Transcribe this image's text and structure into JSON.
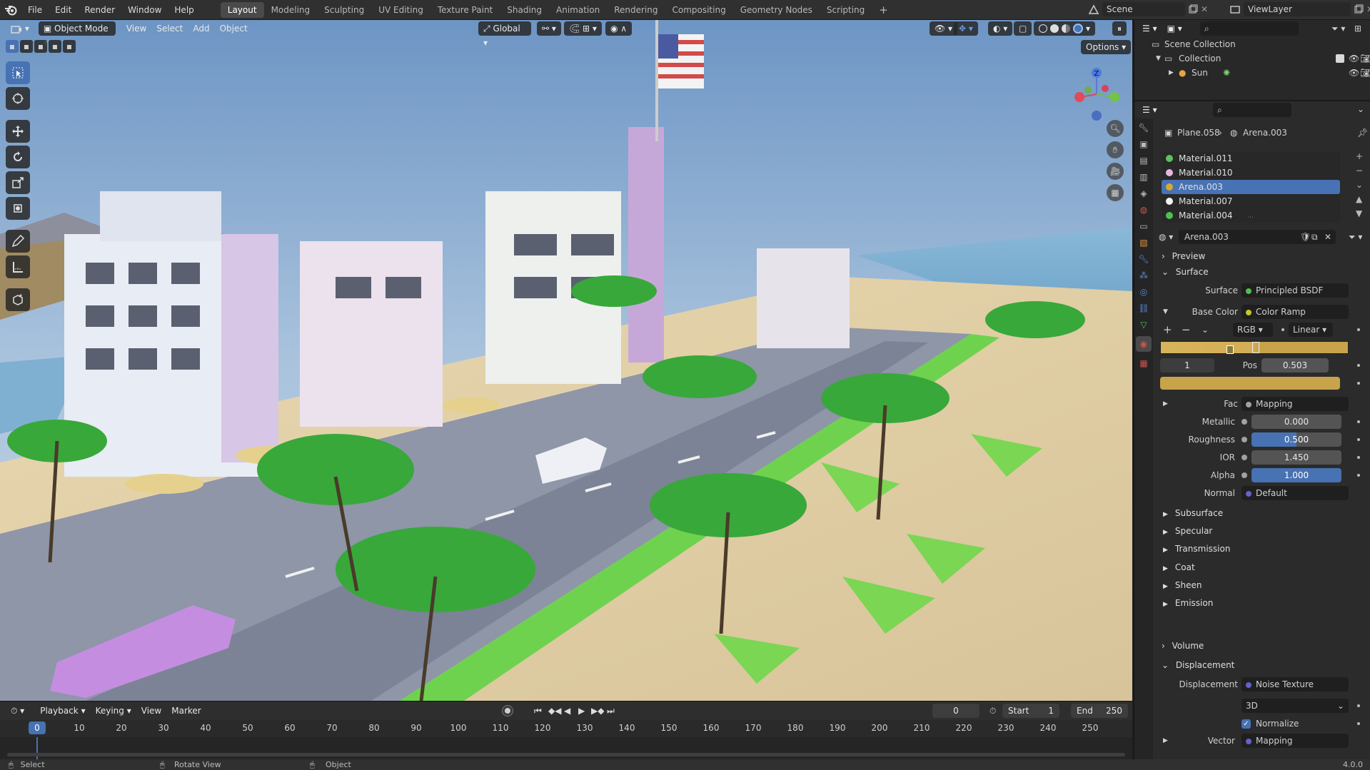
{
  "colors": {
    "accent": "#4772b3",
    "header": "#303030",
    "panel": "#2b2b2b",
    "socket_yellow": "#c7c729",
    "socket_purple": "#6363c7",
    "socket_gray": "#a1a1a1",
    "ramp_left": "#d7b45a",
    "ramp_right": "#c7a44a"
  },
  "menu": [
    "File",
    "Edit",
    "Render",
    "Window",
    "Help"
  ],
  "workspaces": [
    "Layout",
    "Modeling",
    "Sculpting",
    "UV Editing",
    "Texture Paint",
    "Shading",
    "Animation",
    "Rendering",
    "Compositing",
    "Geometry Nodes",
    "Scripting"
  ],
  "workspace_active": "Layout",
  "scene": {
    "name": "Scene",
    "view_layer": "ViewLayer"
  },
  "viewport": {
    "mode": "Object Mode",
    "menus": [
      "View",
      "Select",
      "Add",
      "Object"
    ],
    "orientation": "Global",
    "options": "Options",
    "gizmo_axis": "Z"
  },
  "timeline": {
    "menus": [
      "Playback",
      "Keying",
      "View",
      "Marker"
    ],
    "current_frame": "0",
    "start_label": "Start",
    "start": "1",
    "end_label": "End",
    "end": "250",
    "ticks": [
      "0",
      "10",
      "20",
      "30",
      "40",
      "50",
      "60",
      "70",
      "80",
      "90",
      "100",
      "110",
      "120",
      "130",
      "140",
      "150",
      "160",
      "170",
      "180",
      "190",
      "200",
      "210",
      "220",
      "230",
      "240",
      "250"
    ]
  },
  "status": {
    "select": "Select",
    "rotate": "Rotate View",
    "object": "Object",
    "version": "4.0.0"
  },
  "outliner": {
    "scene_collection": "Scene Collection",
    "collection": "Collection",
    "sun": "Sun"
  },
  "properties": {
    "breadcrumb_object": "Plane.058",
    "breadcrumb_material": "Arena.003",
    "materials": [
      "Material.011",
      "Material.010",
      "Arena.003",
      "Material.007",
      "Material.004"
    ],
    "material_colors": [
      "#5dc25d",
      "#e6b8d8",
      "#d9a834",
      "#f2f2f2",
      "#4fbf4f"
    ],
    "selected_material_index": 2,
    "material_name": "Arena.003",
    "preview": "Preview",
    "surface_panel": "Surface",
    "surface_label": "Surface",
    "surface_value": "Principled BSDF",
    "base_color_label": "Base Color",
    "base_color_value": "Color Ramp",
    "ramp_mode": "RGB",
    "ramp_interp": "Linear",
    "ramp_index": "1",
    "pos_label": "Pos",
    "pos_value": "0.503",
    "fac_label": "Fac",
    "fac_value": "Mapping",
    "metallic_label": "Metallic",
    "metallic": "0.000",
    "roughness_label": "Roughness",
    "roughness": "0.500",
    "ior_label": "IOR",
    "ior": "1.450",
    "alpha_label": "Alpha",
    "alpha": "1.000",
    "normal_label": "Normal",
    "normal": "Default",
    "subpanels": [
      "Subsurface",
      "Specular",
      "Transmission",
      "Coat",
      "Sheen",
      "Emission"
    ],
    "volume": "Volume",
    "displacement_panel": "Displacement",
    "displacement_label": "Displacement",
    "displacement_value": "Noise Texture",
    "dimension": "3D",
    "normalize": "Normalize",
    "vector_label": "Vector",
    "vector_value": "Mapping"
  }
}
